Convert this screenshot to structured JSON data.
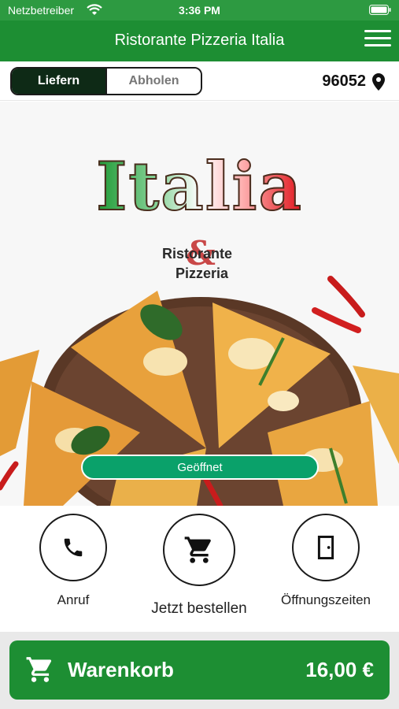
{
  "status_bar": {
    "carrier": "Netzbetreiber",
    "time": "3:36 PM"
  },
  "header": {
    "title": "Ristorante Pizzeria Italia"
  },
  "mode": {
    "options": [
      "Liefern",
      "Abholen"
    ],
    "selected": "Liefern"
  },
  "location": {
    "postal_code": "96052"
  },
  "hero": {
    "brand": "Italia",
    "subtitle_line1": "Ristorante",
    "subtitle_amp": "&",
    "subtitle_line2": "Pizzeria",
    "status_badge": "Geöffnet"
  },
  "actions": [
    {
      "label": "Anruf",
      "icon": "phone-icon"
    },
    {
      "label": "Jetzt bestellen",
      "icon": "cart-icon"
    },
    {
      "label": "Öffnungszeiten",
      "icon": "door-icon"
    }
  ],
  "cart": {
    "label": "Warenkorb",
    "total": "16,00 €"
  },
  "colors": {
    "primary": "#1d8e33",
    "status_bar": "#2d9a41",
    "badge": "#0aa16a",
    "toggle_active": "#0e2a16"
  }
}
